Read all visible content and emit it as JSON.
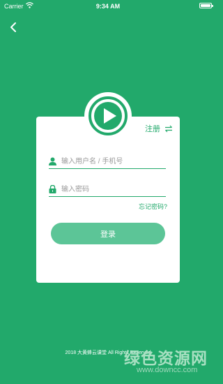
{
  "status_bar": {
    "carrier": "Carrier",
    "time": "9:34 AM"
  },
  "register_label": "注册",
  "username": {
    "placeholder": "输入用户名 / 手机号",
    "value": ""
  },
  "password": {
    "placeholder": "输入密码",
    "value": ""
  },
  "forgot_label": "忘记密码?",
  "login_label": "登录",
  "footer_text": "2018 大黄蜂云课堂 All Rights Reserved",
  "watermark": {
    "main": "绿色资源网",
    "sub": "www.downcc.com"
  },
  "colors": {
    "primary": "#22a96b",
    "button": "#5cc597",
    "card": "#ffffff"
  },
  "icons": [
    "back-arrow-icon",
    "wifi-icon",
    "battery-icon",
    "play-logo-icon",
    "swap-arrows-icon",
    "user-icon",
    "lock-icon"
  ]
}
